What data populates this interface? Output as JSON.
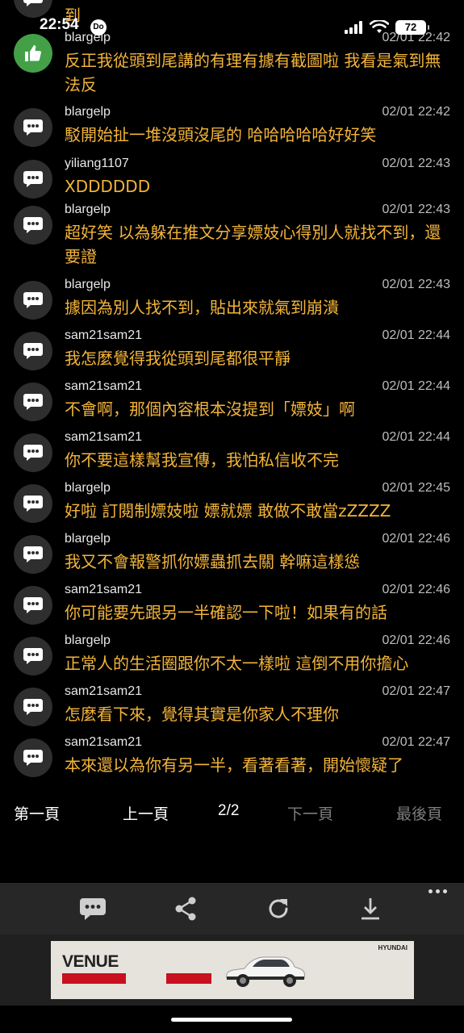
{
  "status_bar": {
    "time": "22:54",
    "notification_badge": "Do",
    "battery": "72"
  },
  "top_partial": {
    "text": "到"
  },
  "messages": [
    {
      "user": "blargelp",
      "time": "02/01 22:42",
      "text": "反正我從頭到尾講的有理有據有截圖啦 我看是氣到無法反",
      "avatar": "like-icon"
    },
    {
      "user": "blargelp",
      "time": "02/01 22:42",
      "text": "駁開始扯一堆沒頭沒尾的 哈哈哈哈哈好好笑",
      "avatar": "chat-bubble-icon"
    },
    {
      "user": "yiliang1107",
      "time": "02/01 22:43",
      "text": "XDDDDDD",
      "avatar": "chat-bubble-icon"
    },
    {
      "user": "blargelp",
      "time": "02/01 22:43",
      "text": "超好笑 以為躲在推文分享嫖妓心得別人就找不到，還要證",
      "avatar": "chat-bubble-icon"
    },
    {
      "user": "blargelp",
      "time": "02/01 22:43",
      "text": "據因為別人找不到，貼出來就氣到崩潰",
      "avatar": "chat-bubble-icon"
    },
    {
      "user": "sam21sam21",
      "time": "02/01 22:44",
      "text": "我怎麼覺得我從頭到尾都很平靜",
      "avatar": "chat-bubble-icon"
    },
    {
      "user": "sam21sam21",
      "time": "02/01 22:44",
      "text": "不會啊，那個內容根本沒提到「嫖妓」啊",
      "avatar": "chat-bubble-icon"
    },
    {
      "user": "sam21sam21",
      "time": "02/01 22:44",
      "text": "你不要這樣幫我宣傳，我怕私信收不完",
      "avatar": "chat-bubble-icon"
    },
    {
      "user": "blargelp",
      "time": "02/01 22:45",
      "text": "好啦 訂閱制嫖妓啦 嫖就嫖 敢做不敢當zZZZZ",
      "avatar": "chat-bubble-icon"
    },
    {
      "user": "blargelp",
      "time": "02/01 22:46",
      "text": "我又不會報警抓你嫖蟲抓去關 幹嘛這樣慫",
      "avatar": "chat-bubble-icon"
    },
    {
      "user": "sam21sam21",
      "time": "02/01 22:46",
      "text": "你可能要先跟另一半確認一下啦！如果有的話",
      "avatar": "chat-bubble-icon"
    },
    {
      "user": "blargelp",
      "time": "02/01 22:46",
      "text": "正常人的生活圈跟你不太一樣啦 這倒不用你擔心",
      "avatar": "chat-bubble-icon"
    },
    {
      "user": "sam21sam21",
      "time": "02/01 22:47",
      "text": "怎麼看下來，覺得其實是你家人不理你",
      "avatar": "chat-bubble-icon"
    },
    {
      "user": "sam21sam21",
      "time": "02/01 22:47",
      "text": "本來還以為你有另一半，看著看著，開始懷疑了",
      "avatar": "chat-bubble-icon"
    }
  ],
  "pager": {
    "first": "第一頁",
    "prev": "上一頁",
    "current": "2/2",
    "next": "下一頁",
    "last": "最後頁"
  },
  "toolbar": {
    "icons": [
      "comment-icon",
      "share-icon",
      "refresh-icon",
      "download-icon",
      "more-icon"
    ]
  },
  "ad": {
    "headline": "VENUE",
    "brand": "HYUNDAI",
    "accent_color": "#c8101e"
  },
  "colors": {
    "background": "#000000",
    "message_text": "#f3b43a",
    "like_avatar": "#43a047",
    "avatar": "#2e2e2e",
    "toolbar": "#272727"
  }
}
